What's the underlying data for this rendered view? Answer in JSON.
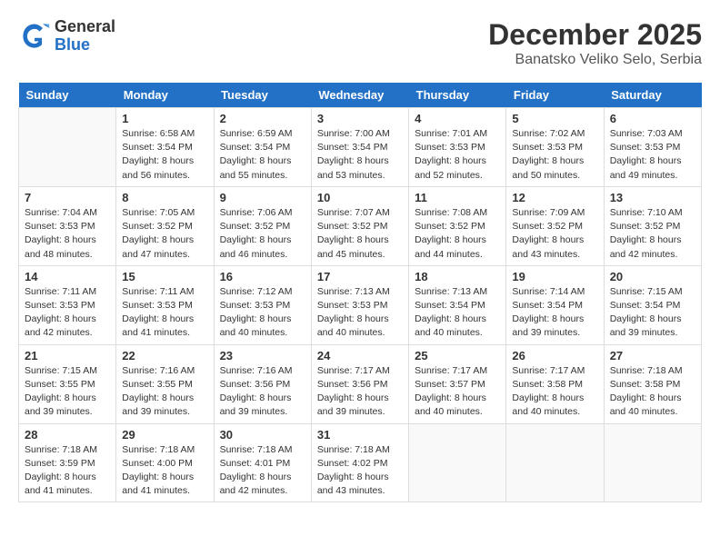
{
  "header": {
    "logo_general": "General",
    "logo_blue": "Blue",
    "month_year": "December 2025",
    "location": "Banatsko Veliko Selo, Serbia"
  },
  "days_of_week": [
    "Sunday",
    "Monday",
    "Tuesday",
    "Wednesday",
    "Thursday",
    "Friday",
    "Saturday"
  ],
  "weeks": [
    [
      {
        "day": "",
        "empty": true
      },
      {
        "day": "1",
        "sunrise": "Sunrise: 6:58 AM",
        "sunset": "Sunset: 3:54 PM",
        "daylight": "Daylight: 8 hours and 56 minutes."
      },
      {
        "day": "2",
        "sunrise": "Sunrise: 6:59 AM",
        "sunset": "Sunset: 3:54 PM",
        "daylight": "Daylight: 8 hours and 55 minutes."
      },
      {
        "day": "3",
        "sunrise": "Sunrise: 7:00 AM",
        "sunset": "Sunset: 3:54 PM",
        "daylight": "Daylight: 8 hours and 53 minutes."
      },
      {
        "day": "4",
        "sunrise": "Sunrise: 7:01 AM",
        "sunset": "Sunset: 3:53 PM",
        "daylight": "Daylight: 8 hours and 52 minutes."
      },
      {
        "day": "5",
        "sunrise": "Sunrise: 7:02 AM",
        "sunset": "Sunset: 3:53 PM",
        "daylight": "Daylight: 8 hours and 50 minutes."
      },
      {
        "day": "6",
        "sunrise": "Sunrise: 7:03 AM",
        "sunset": "Sunset: 3:53 PM",
        "daylight": "Daylight: 8 hours and 49 minutes."
      }
    ],
    [
      {
        "day": "7",
        "sunrise": "Sunrise: 7:04 AM",
        "sunset": "Sunset: 3:53 PM",
        "daylight": "Daylight: 8 hours and 48 minutes."
      },
      {
        "day": "8",
        "sunrise": "Sunrise: 7:05 AM",
        "sunset": "Sunset: 3:52 PM",
        "daylight": "Daylight: 8 hours and 47 minutes."
      },
      {
        "day": "9",
        "sunrise": "Sunrise: 7:06 AM",
        "sunset": "Sunset: 3:52 PM",
        "daylight": "Daylight: 8 hours and 46 minutes."
      },
      {
        "day": "10",
        "sunrise": "Sunrise: 7:07 AM",
        "sunset": "Sunset: 3:52 PM",
        "daylight": "Daylight: 8 hours and 45 minutes."
      },
      {
        "day": "11",
        "sunrise": "Sunrise: 7:08 AM",
        "sunset": "Sunset: 3:52 PM",
        "daylight": "Daylight: 8 hours and 44 minutes."
      },
      {
        "day": "12",
        "sunrise": "Sunrise: 7:09 AM",
        "sunset": "Sunset: 3:52 PM",
        "daylight": "Daylight: 8 hours and 43 minutes."
      },
      {
        "day": "13",
        "sunrise": "Sunrise: 7:10 AM",
        "sunset": "Sunset: 3:52 PM",
        "daylight": "Daylight: 8 hours and 42 minutes."
      }
    ],
    [
      {
        "day": "14",
        "sunrise": "Sunrise: 7:11 AM",
        "sunset": "Sunset: 3:53 PM",
        "daylight": "Daylight: 8 hours and 42 minutes."
      },
      {
        "day": "15",
        "sunrise": "Sunrise: 7:11 AM",
        "sunset": "Sunset: 3:53 PM",
        "daylight": "Daylight: 8 hours and 41 minutes."
      },
      {
        "day": "16",
        "sunrise": "Sunrise: 7:12 AM",
        "sunset": "Sunset: 3:53 PM",
        "daylight": "Daylight: 8 hours and 40 minutes."
      },
      {
        "day": "17",
        "sunrise": "Sunrise: 7:13 AM",
        "sunset": "Sunset: 3:53 PM",
        "daylight": "Daylight: 8 hours and 40 minutes."
      },
      {
        "day": "18",
        "sunrise": "Sunrise: 7:13 AM",
        "sunset": "Sunset: 3:54 PM",
        "daylight": "Daylight: 8 hours and 40 minutes."
      },
      {
        "day": "19",
        "sunrise": "Sunrise: 7:14 AM",
        "sunset": "Sunset: 3:54 PM",
        "daylight": "Daylight: 8 hours and 39 minutes."
      },
      {
        "day": "20",
        "sunrise": "Sunrise: 7:15 AM",
        "sunset": "Sunset: 3:54 PM",
        "daylight": "Daylight: 8 hours and 39 minutes."
      }
    ],
    [
      {
        "day": "21",
        "sunrise": "Sunrise: 7:15 AM",
        "sunset": "Sunset: 3:55 PM",
        "daylight": "Daylight: 8 hours and 39 minutes."
      },
      {
        "day": "22",
        "sunrise": "Sunrise: 7:16 AM",
        "sunset": "Sunset: 3:55 PM",
        "daylight": "Daylight: 8 hours and 39 minutes."
      },
      {
        "day": "23",
        "sunrise": "Sunrise: 7:16 AM",
        "sunset": "Sunset: 3:56 PM",
        "daylight": "Daylight: 8 hours and 39 minutes."
      },
      {
        "day": "24",
        "sunrise": "Sunrise: 7:17 AM",
        "sunset": "Sunset: 3:56 PM",
        "daylight": "Daylight: 8 hours and 39 minutes."
      },
      {
        "day": "25",
        "sunrise": "Sunrise: 7:17 AM",
        "sunset": "Sunset: 3:57 PM",
        "daylight": "Daylight: 8 hours and 40 minutes."
      },
      {
        "day": "26",
        "sunrise": "Sunrise: 7:17 AM",
        "sunset": "Sunset: 3:58 PM",
        "daylight": "Daylight: 8 hours and 40 minutes."
      },
      {
        "day": "27",
        "sunrise": "Sunrise: 7:18 AM",
        "sunset": "Sunset: 3:58 PM",
        "daylight": "Daylight: 8 hours and 40 minutes."
      }
    ],
    [
      {
        "day": "28",
        "sunrise": "Sunrise: 7:18 AM",
        "sunset": "Sunset: 3:59 PM",
        "daylight": "Daylight: 8 hours and 41 minutes."
      },
      {
        "day": "29",
        "sunrise": "Sunrise: 7:18 AM",
        "sunset": "Sunset: 4:00 PM",
        "daylight": "Daylight: 8 hours and 41 minutes."
      },
      {
        "day": "30",
        "sunrise": "Sunrise: 7:18 AM",
        "sunset": "Sunset: 4:01 PM",
        "daylight": "Daylight: 8 hours and 42 minutes."
      },
      {
        "day": "31",
        "sunrise": "Sunrise: 7:18 AM",
        "sunset": "Sunset: 4:02 PM",
        "daylight": "Daylight: 8 hours and 43 minutes."
      },
      {
        "day": "",
        "empty": true
      },
      {
        "day": "",
        "empty": true
      },
      {
        "day": "",
        "empty": true
      }
    ]
  ]
}
